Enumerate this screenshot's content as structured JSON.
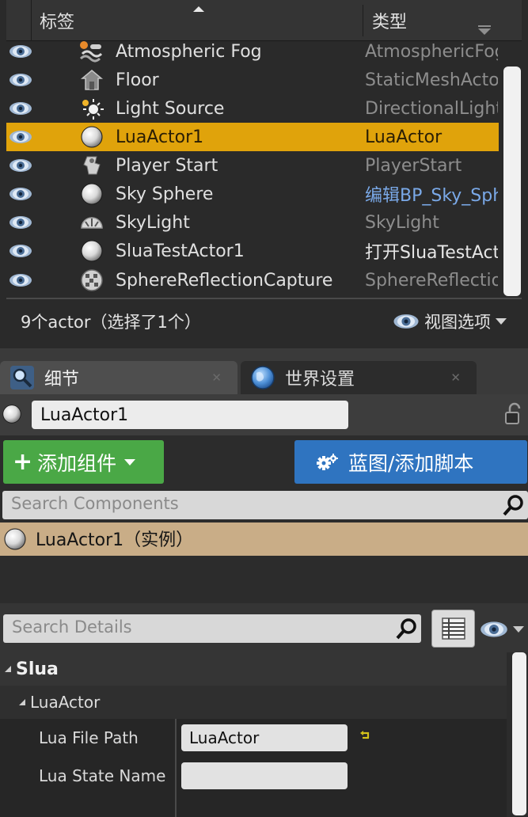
{
  "outliner": {
    "columns": {
      "label": "标签",
      "type": "类型"
    },
    "rows": [
      {
        "label": "Atmospheric Fog",
        "type": "AtmosphericFog",
        "icon": "fog-icon",
        "selected": false,
        "type_style": "plain"
      },
      {
        "label": "Floor",
        "type": "StaticMeshActor",
        "icon": "static-mesh-icon",
        "selected": false,
        "type_style": "plain"
      },
      {
        "label": "Light Source",
        "type": "DirectionalLight",
        "icon": "sun-light-icon",
        "selected": false,
        "type_style": "plain"
      },
      {
        "label": "LuaActor1",
        "type": "LuaActor",
        "icon": "sphere-icon",
        "selected": true,
        "type_style": "plain"
      },
      {
        "label": "Player Start",
        "type": "PlayerStart",
        "icon": "player-start-icon",
        "selected": false,
        "type_style": "plain"
      },
      {
        "label": "Sky Sphere",
        "type": "编辑BP_Sky_Sphere",
        "icon": "sphere-icon",
        "selected": false,
        "type_style": "link"
      },
      {
        "label": "SkyLight",
        "type": "SkyLight",
        "icon": "skylight-icon",
        "selected": false,
        "type_style": "plain"
      },
      {
        "label": "SluaTestActor1",
        "type": "打开SluaTestActor",
        "icon": "sphere-icon",
        "selected": false,
        "type_style": "open"
      },
      {
        "label": "SphereReflectionCapture",
        "type": "SphereReflectionCapture",
        "icon": "reflection-capture-icon",
        "selected": false,
        "type_style": "plain"
      }
    ],
    "footer": {
      "count": "9个actor（选择了1个）",
      "view_options": "视图选项"
    }
  },
  "tabs": [
    {
      "label": "细节",
      "icon": "magnifier-icon",
      "active": true
    },
    {
      "label": "世界设置",
      "icon": "globe-icon",
      "active": false
    }
  ],
  "details": {
    "actor_name": "LuaActor1",
    "add_component": "添加组件",
    "blueprint": "蓝图/添加脚本",
    "search_components_placeholder": "Search Components",
    "component_instance": "LuaActor1（实例）",
    "search_details_placeholder": "Search Details",
    "category": "Slua",
    "subcategory": "LuaActor",
    "properties": [
      {
        "label": "Lua File Path",
        "value": "LuaActor"
      },
      {
        "label": "Lua State Name",
        "value": ""
      }
    ]
  },
  "colors": {
    "selection": "#e0a30b",
    "add_button": "#4aa846",
    "blueprint_button": "#2f74c0",
    "component_row": "#c9ad87",
    "link_text": "#7aa9e8"
  }
}
